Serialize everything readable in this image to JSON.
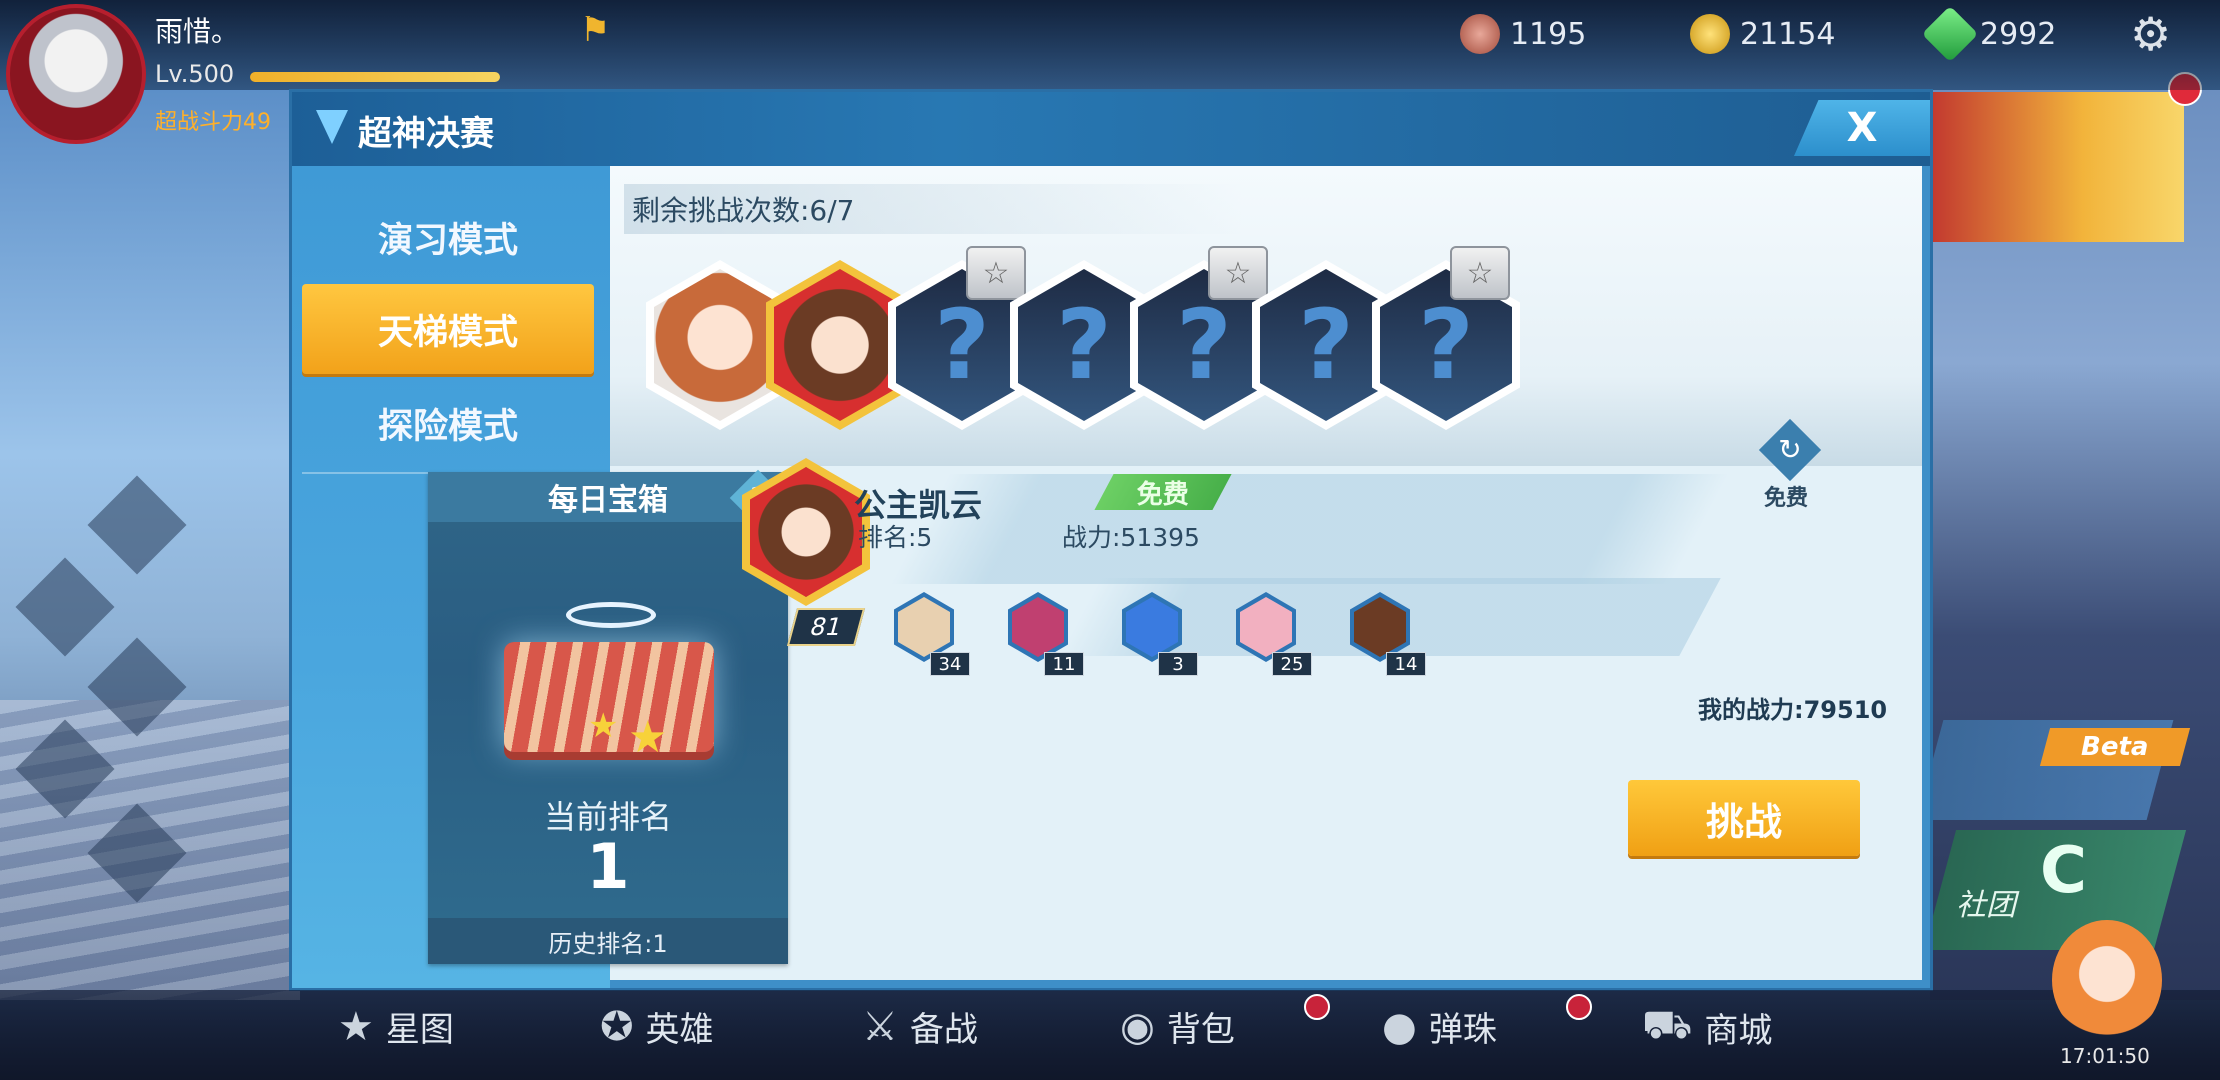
{
  "player": {
    "name": "雨惜。",
    "level": "Lv.500",
    "level_progress": 1.0,
    "power_label": "超战斗力49"
  },
  "resources": [
    {
      "icon": "shell-icon",
      "value": "1195",
      "color": "#c86a5a"
    },
    {
      "icon": "gold-coin-icon",
      "value": "21154",
      "color": "#e4b424"
    },
    {
      "icon": "green-gem-icon",
      "value": "2992",
      "color": "#3cc45a"
    }
  ],
  "dialog": {
    "title": "超神决赛",
    "close_label": "X",
    "modes": [
      {
        "label": "演习模式",
        "active": false
      },
      {
        "label": "天梯模式",
        "active": true
      },
      {
        "label": "探险模式",
        "active": false
      }
    ],
    "remaining_text": "剩余挑战次数:6/7",
    "slots": [
      {
        "state": "hero-1",
        "locked": false
      },
      {
        "state": "hero-2",
        "locked": false
      },
      {
        "state": "unknown",
        "locked": true,
        "glyph": "?"
      },
      {
        "state": "unknown",
        "locked": false,
        "glyph": "?"
      },
      {
        "state": "unknown",
        "locked": true,
        "glyph": "?"
      },
      {
        "state": "unknown",
        "locked": false,
        "glyph": "?"
      },
      {
        "state": "unknown",
        "locked": true,
        "glyph": "?"
      }
    ],
    "daily_chest": {
      "title": "每日宝箱",
      "help_glyph": "?",
      "current_rank_label": "当前排名",
      "current_rank": "1",
      "history_rank": "历史排名:1"
    },
    "opponent": {
      "name": "公主凯云",
      "level": "81",
      "rank": "排名:5",
      "power": "战力:51395",
      "free_tag": "免费",
      "refresh_label": "免费",
      "team": [
        {
          "level": "34",
          "color": "#e8d0b0"
        },
        {
          "level": "11",
          "color": "#c04070"
        },
        {
          "level": "3",
          "color": "#3a7be0"
        },
        {
          "level": "25",
          "color": "#f2b0c0"
        },
        {
          "level": "14",
          "color": "#6b3b24"
        }
      ]
    },
    "my_power": "我的战力:79510",
    "challenge_label": "挑战"
  },
  "bottom_nav": [
    {
      "label": "星图",
      "icon": "star-icon",
      "badge": false
    },
    {
      "label": "英雄",
      "icon": "hero-star-icon",
      "badge": false
    },
    {
      "label": "备战",
      "icon": "crossed-swords-icon",
      "badge": false
    },
    {
      "label": "背包",
      "icon": "backpack-icon",
      "badge": true
    },
    {
      "label": "弹珠",
      "icon": "marbles-icon",
      "badge": true
    },
    {
      "label": "商城",
      "icon": "cart-icon",
      "badge": false
    }
  ],
  "right_side": {
    "beta_label": "Beta",
    "club_label": "社团",
    "club_glyph": "C",
    "time": "17:01:50"
  }
}
